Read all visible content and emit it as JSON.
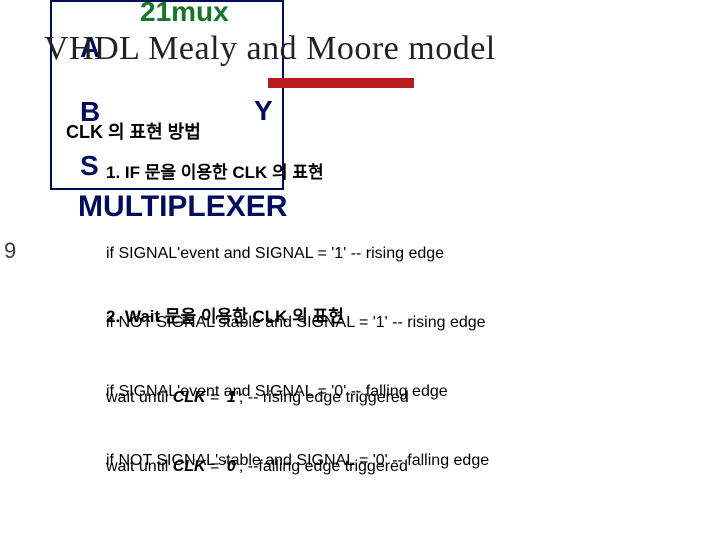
{
  "bg": {
    "mux": "21mux",
    "A": "A",
    "B": "B",
    "S": "S",
    "Y": "Y",
    "multiplexer": "MULTIPLEXER",
    "nine": "9"
  },
  "title": "VHDL Mealy and Moore model",
  "section_clk": "CLK 의 표현 방법",
  "sub_if": "1. IF 문을 이용한 CLK 의 표현",
  "code_if_l1": "if SIGNAL'event and SIGNAL = '1' -- rising edge",
  "code_if_l2": "if NOT SIGNAL'stable and SIGNAL = '1' -- rising edge",
  "code_if_l3": "if SIGNAL'event and SIGNAL = '0' -- falling edge",
  "code_if_l4": "if NOT SIGNAL'stable and SIGNAL = '0' -- falling edge",
  "sub_wait": "2. Wait 문을 이용한 CLK 의 표현",
  "wait_prefix": "wait until ",
  "wait_clk": "CLK",
  "wait_eq": " = '",
  "wait_r_val": "1",
  "wait_r_suffix": "'; -- rising edge triggered",
  "wait_f_val": "0",
  "wait_f_suffix": "'; --falling edge triggered"
}
